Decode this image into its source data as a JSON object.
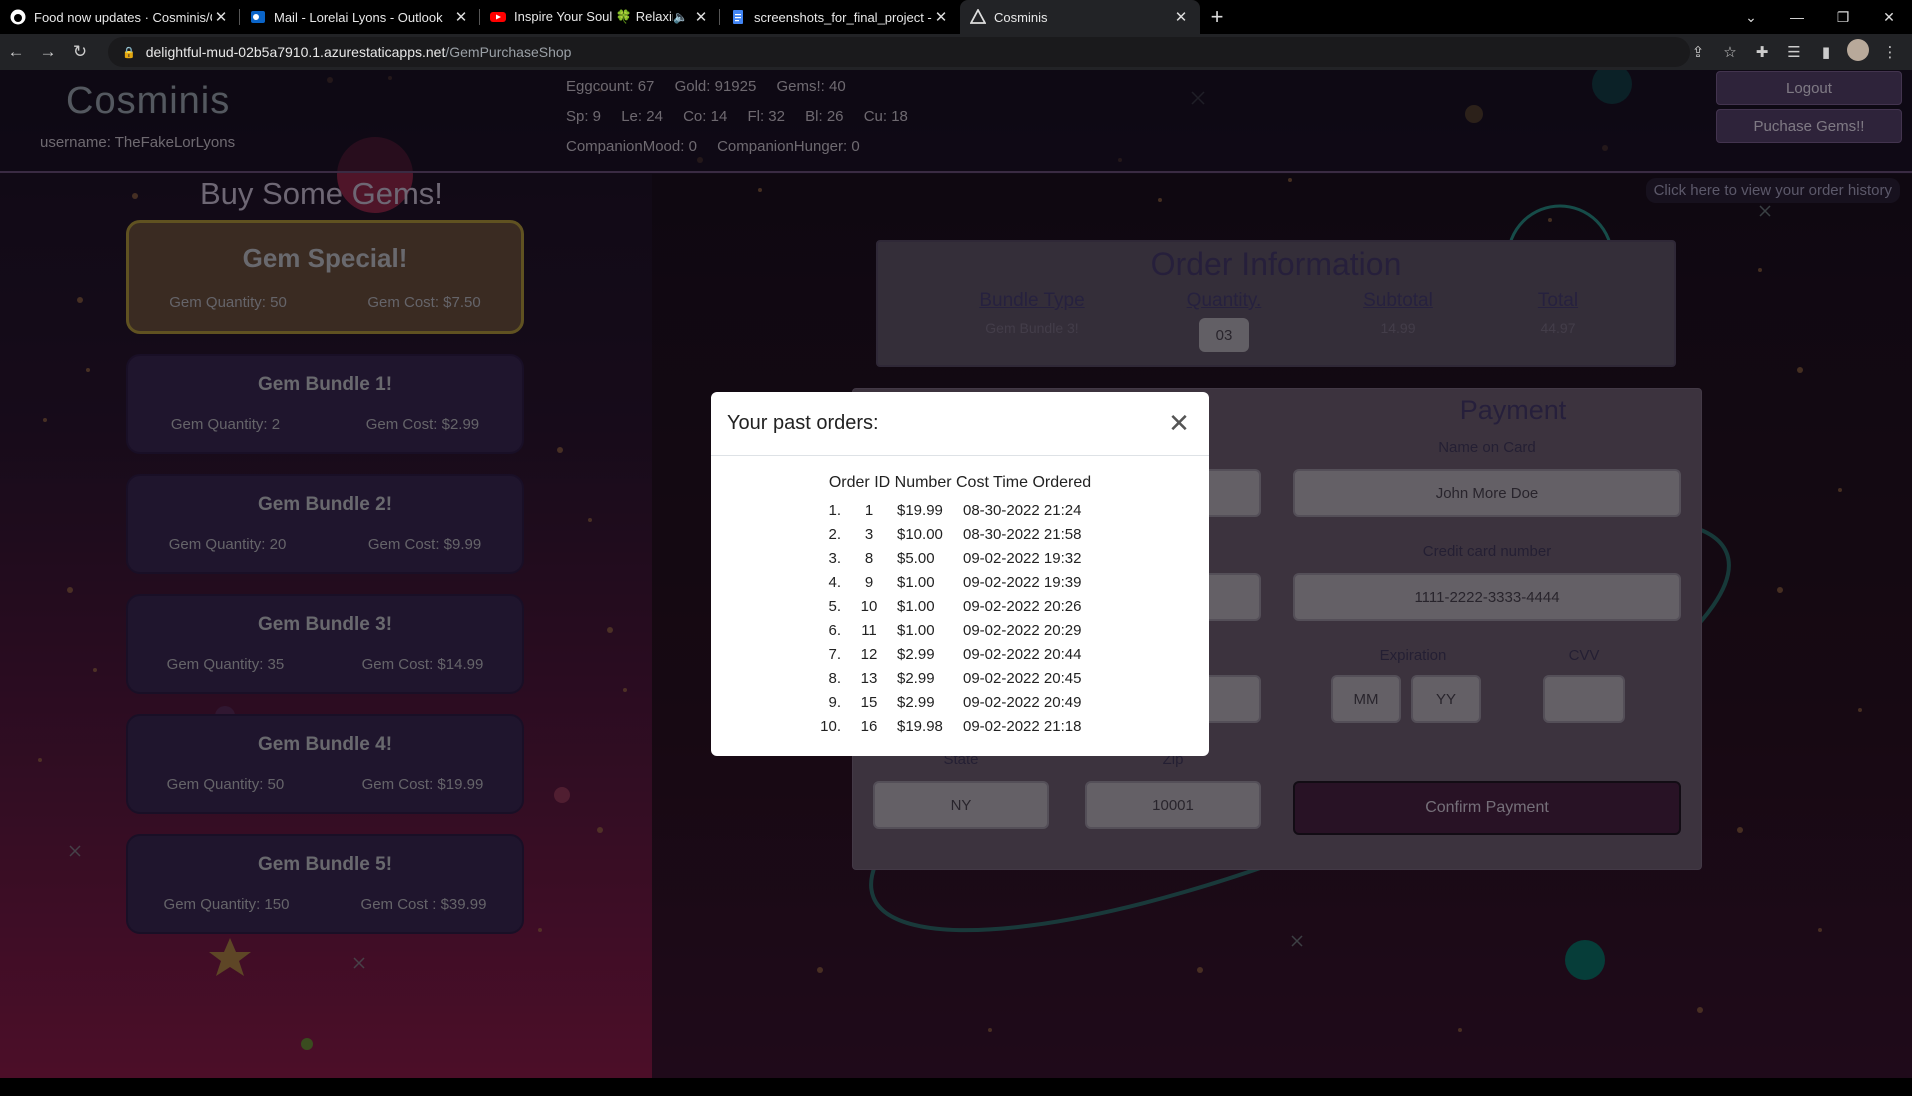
{
  "browser": {
    "tabs": [
      {
        "title": "Food now updates · Cosminis/Co",
        "icon": "github-icon",
        "active": false
      },
      {
        "title": "Mail - Lorelai Lyons - Outlook",
        "icon": "outlook-icon",
        "active": false
      },
      {
        "title": "Inspire Your Soul 🍀 Relaxing",
        "icon": "youtube-icon",
        "active": false
      },
      {
        "title": "screenshots_for_final_project - G",
        "icon": "docs-icon",
        "active": false
      },
      {
        "title": "Cosminis",
        "icon": "angular-icon",
        "active": true
      }
    ],
    "url_host": "delightful-mud-02b5a7910.1.azurestaticapps.net",
    "url_path": "/GemPurchaseShop"
  },
  "header": {
    "logo": "Cosminis",
    "username": "username: TheFakeLorLyons",
    "stats_row1": [
      "Eggcount: 67",
      "Gold: 91925",
      "Gems!: 40"
    ],
    "stats_row2": [
      "Sp: 9",
      "Le: 24",
      "Co: 14",
      "Fl: 32",
      "Bl: 26",
      "Cu: 18"
    ],
    "stats_row3": [
      "CompanionMood: 0",
      "CompanionHunger: 0"
    ],
    "logout_label": "Logout",
    "purchase_label": "Puchase Gems!!",
    "history_link": "Click here to view your order history"
  },
  "shop": {
    "title": "Buy Some Gems!",
    "bundles": [
      {
        "name": "Gem Special!",
        "qty": "Gem Quantity: 50",
        "cost": "Gem Cost: $7.50"
      },
      {
        "name": "Gem Bundle 1!",
        "qty": "Gem Quantity: 2",
        "cost": "Gem Cost: $2.99"
      },
      {
        "name": "Gem Bundle 2!",
        "qty": "Gem Quantity: 20",
        "cost": "Gem Cost: $9.99"
      },
      {
        "name": "Gem Bundle 3!",
        "qty": "Gem Quantity: 35",
        "cost": "Gem Cost: $14.99"
      },
      {
        "name": "Gem Bundle 4!",
        "qty": "Gem Quantity: 50",
        "cost": "Gem Cost: $19.99"
      },
      {
        "name": "Gem Bundle 5!",
        "qty": "Gem Quantity: 150",
        "cost": "Gem Cost : $39.99"
      }
    ]
  },
  "order_info": {
    "title": "Order Information",
    "headers": [
      "Bundle Type",
      "Quantity.",
      "Subtotal",
      "Total"
    ],
    "bundle_type": "Gem Bundle 3!",
    "quantity": "03",
    "subtotal": "14.99",
    "total": "44.97"
  },
  "payment": {
    "title": "Payment",
    "name_label": "Name on Card",
    "name_value": "John More Doe",
    "card_label": "Credit card number",
    "card_value": "1111-2222-3333-4444",
    "expiration_label": "Expiration",
    "mm_placeholder": "MM",
    "yy_placeholder": "YY",
    "cvv_label": "CVV",
    "state_label": "State",
    "state_value": "NY",
    "zip_label": "Zip",
    "zip_value": "10001",
    "confirm_label": "Confirm Payment"
  },
  "modal": {
    "title": "Your past orders:",
    "columns_header": "Order ID Number Cost Time Ordered",
    "orders": [
      {
        "n": "1.",
        "id": "1",
        "cost": "$19.99",
        "time": "08-30-2022 21:24"
      },
      {
        "n": "2.",
        "id": "3",
        "cost": "$10.00",
        "time": "08-30-2022 21:58"
      },
      {
        "n": "3.",
        "id": "8",
        "cost": "$5.00",
        "time": "09-02-2022 19:32"
      },
      {
        "n": "4.",
        "id": "9",
        "cost": "$1.00",
        "time": "09-02-2022 19:39"
      },
      {
        "n": "5.",
        "id": "10",
        "cost": "$1.00",
        "time": "09-02-2022 20:26"
      },
      {
        "n": "6.",
        "id": "11",
        "cost": "$1.00",
        "time": "09-02-2022 20:29"
      },
      {
        "n": "7.",
        "id": "12",
        "cost": "$2.99",
        "time": "09-02-2022 20:44"
      },
      {
        "n": "8.",
        "id": "13",
        "cost": "$2.99",
        "time": "09-02-2022 20:45"
      },
      {
        "n": "9.",
        "id": "15",
        "cost": "$2.99",
        "time": "09-02-2022 20:49"
      },
      {
        "n": "10.",
        "id": "16",
        "cost": "$19.98",
        "time": "09-02-2022 21:18"
      }
    ]
  },
  "colors": {
    "accent_purple": "#55406b",
    "special_border": "#b0963c",
    "page_bottom": "#8b1a4a"
  }
}
